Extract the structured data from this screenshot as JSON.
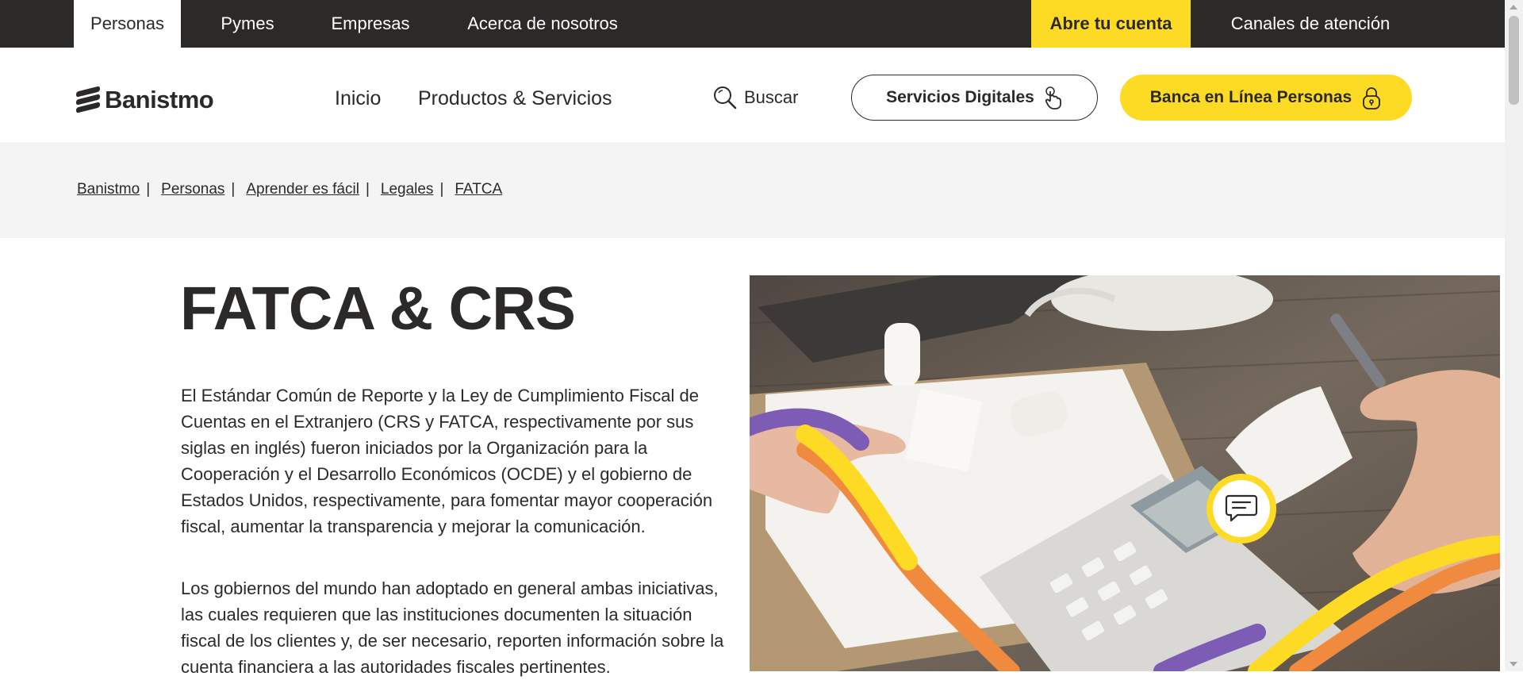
{
  "topbar": {
    "tabs": [
      {
        "label": "Personas",
        "active": true
      },
      {
        "label": "Pymes"
      },
      {
        "label": "Empresas"
      },
      {
        "label": "Acerca de nosotros"
      }
    ],
    "cta_label": "Abre tu cuenta",
    "channels_label": "Canales de atención"
  },
  "header": {
    "logo_text": "Banistmo",
    "nav": [
      {
        "label": "Inicio",
        "current": true
      },
      {
        "label": "Productos & Servicios"
      }
    ],
    "search_label": "Buscar",
    "digital_button_label": "Servicios Digitales",
    "online_button_label": "Banca en Línea Personas"
  },
  "breadcrumb": {
    "items": [
      "Banistmo",
      "Personas",
      "Aprender es fácil",
      "Legales",
      "FATCA"
    ]
  },
  "content": {
    "title": "FATCA & CRS",
    "paragraph_1": "El Estándar Común de Reporte y la Ley de Cumplimiento Fiscal de Cuentas en el Extranjero (CRS y FATCA, respectivamente por sus siglas en inglés) fueron iniciados por la Organización para la Cooperación y el Desarrollo Económicos (OCDE) y el gobierno de Estados Unidos, respectivamente, para fomentar mayor cooperación fiscal, aumentar la transparencia y mejorar la comunicación.",
    "paragraph_2": "Los gobiernos del mundo han adoptado en general ambas iniciativas, las cuales requieren que las instituciones documenten la situación fiscal de los clientes y, de ser necesario, reporten información sobre la cuenta financiera a las autoridades fiscales pertinentes."
  },
  "colors": {
    "brand_yellow": "#fdda24",
    "brand_dark": "#2c2a29",
    "accent_purple": "#7c5cb4",
    "accent_orange": "#f08a3e"
  },
  "icons": {
    "search": "search-icon",
    "touch": "touch-hand-icon",
    "lock": "lock-icon",
    "chat": "chat-icon"
  }
}
